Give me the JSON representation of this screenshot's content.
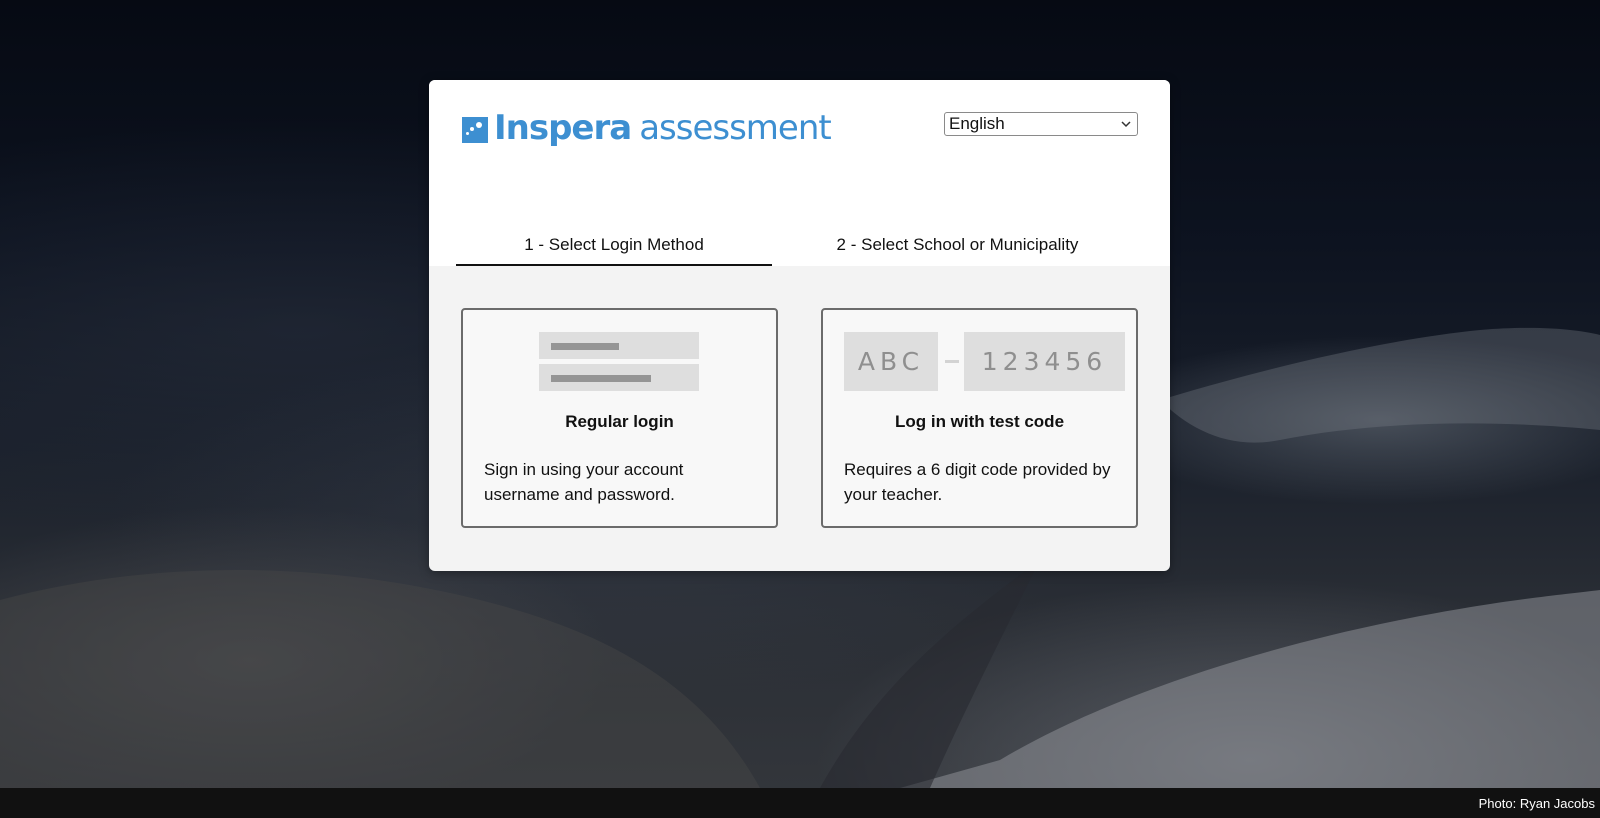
{
  "app": {
    "brand": "Inspera",
    "product": "assessment",
    "brand_color": "#3d8fd1"
  },
  "language": {
    "selected": "English",
    "chevron_icon": "chevron-down-icon"
  },
  "steps": [
    {
      "label": "1 - Select Login Method",
      "active": true
    },
    {
      "label": "2 - Select School or Municipality",
      "active": false
    }
  ],
  "options": {
    "regular": {
      "title": "Regular login",
      "description": "Sign in using your account username and password."
    },
    "code": {
      "title": "Log in with test code",
      "description": "Requires a 6 digit code provided by your teacher.",
      "sample_prefix": "ABC",
      "sample_code": "123456"
    }
  },
  "footer": {
    "credit": "Photo: Ryan Jacobs"
  }
}
